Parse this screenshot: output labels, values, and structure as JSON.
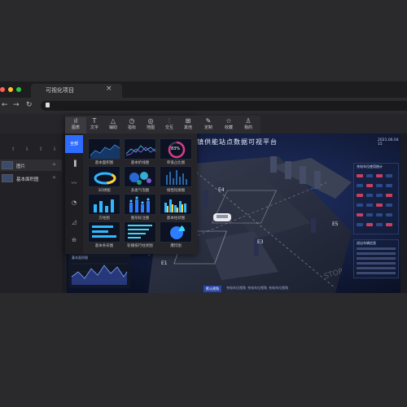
{
  "browser": {
    "tab_title": "可视化项目",
    "tab_close": "×",
    "nav": {
      "back": "←",
      "forward": "→",
      "reload": "↻"
    }
  },
  "toolbar_icons": [
    {
      "icon": "chart-icon",
      "glyph": "ıl",
      "label": "图表"
    },
    {
      "icon": "text-icon",
      "glyph": "T",
      "label": "文字"
    },
    {
      "icon": "shape-icon",
      "glyph": "△",
      "label": "辅助"
    },
    {
      "icon": "indicator-icon",
      "glyph": "◷",
      "label": "指标"
    },
    {
      "icon": "map-icon",
      "glyph": "◎",
      "label": "地图"
    },
    {
      "icon": "interact-icon",
      "glyph": "⫶",
      "label": "交互"
    },
    {
      "icon": "other-icon",
      "glyph": "⊞",
      "label": "其他"
    },
    {
      "icon": "custom-icon",
      "glyph": "✎",
      "label": "定制"
    },
    {
      "icon": "favorite-icon",
      "glyph": "☆",
      "label": "收藏"
    },
    {
      "icon": "mine-icon",
      "glyph": "♙",
      "label": "我的"
    }
  ],
  "categories": [
    {
      "label": "全部",
      "icon": "all-icon",
      "glyph": ""
    },
    {
      "label": "",
      "icon": "bar-chart-icon",
      "glyph": "▐"
    },
    {
      "label": "",
      "icon": "line-chart-icon",
      "glyph": "〰"
    },
    {
      "label": "",
      "icon": "pie-chart-icon",
      "glyph": "◔"
    },
    {
      "label": "",
      "icon": "area-chart-icon",
      "glyph": "◿"
    },
    {
      "label": "",
      "icon": "other-chart-icon",
      "glyph": "⊖"
    }
  ],
  "chart_cards": [
    {
      "label": "基本面积图"
    },
    {
      "label": "基本折线图"
    },
    {
      "label": "单值占比图"
    },
    {
      "label": "3D饼图"
    },
    {
      "label": "多类气泡图"
    },
    {
      "label": "线性轮廓图"
    },
    {
      "label": "方柱图"
    },
    {
      "label": "图形标注图"
    },
    {
      "label": "基本柱状图"
    },
    {
      "label": "基本条形图"
    },
    {
      "label": "轮播排行柱状图"
    },
    {
      "label": "爆炸图"
    }
  ],
  "card_ring_value": "83%",
  "layers": [
    {
      "label": "图片",
      "action": "✧"
    },
    {
      "label": "基本面积图",
      "action": "✧"
    }
  ],
  "layer_tools": "⇧ ⇩ ⇧ ⇩ ▢ ▢",
  "dashboard": {
    "title": "镇供能站点数据可视平台",
    "date": "2021.06.04 15",
    "right_panel_1": "充电车位使用统计",
    "right_panel_2": "进出车辆信息",
    "zones": [
      "E1",
      "E3",
      "E4",
      "E5"
    ],
    "stop_text": "STOP",
    "bottom_tabs": [
      "默认视角",
      "充电车位视角",
      "充电车位视角",
      "充电车位视角"
    ]
  },
  "preview": {
    "title": "基本面积图"
  },
  "colors": {
    "accent": "#2e6bff",
    "panel": "#252529",
    "dashboard_bg": "#0b1226"
  }
}
